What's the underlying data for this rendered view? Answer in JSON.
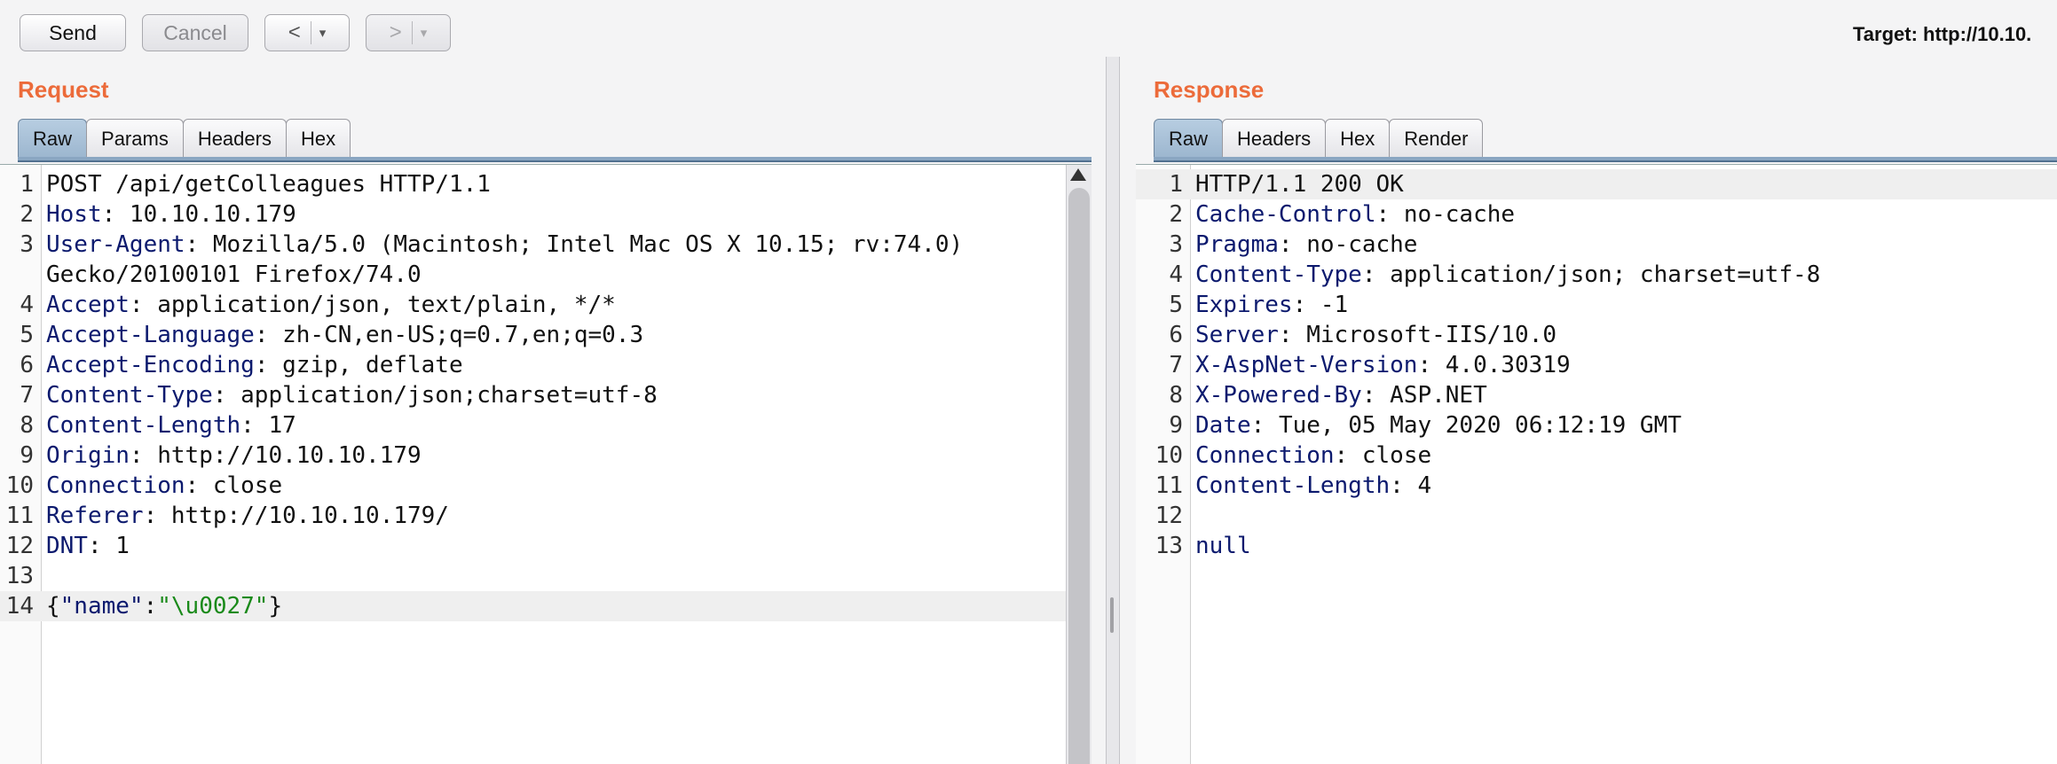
{
  "toolbar": {
    "send_label": "Send",
    "cancel_label": "Cancel",
    "back_label": "<",
    "forward_label": ">",
    "dropdown_glyph": "▾",
    "target_label": "Target: http://10.10."
  },
  "request": {
    "title": "Request",
    "tabs": [
      "Raw",
      "Params",
      "Headers",
      "Hex"
    ],
    "active_tab": "Raw",
    "lines": [
      {
        "n": "1",
        "key": "",
        "val": "POST /api/getColleagues HTTP/1.1"
      },
      {
        "n": "2",
        "key": "Host",
        "val": "10.10.10.179"
      },
      {
        "n": "3",
        "key": "User-Agent",
        "val": "Mozilla/5.0 (Macintosh; Intel Mac OS X 10.15; rv:74.0)"
      },
      {
        "n": "",
        "key": "",
        "val": "Gecko/20100101 Firefox/74.0"
      },
      {
        "n": "4",
        "key": "Accept",
        "val": "application/json, text/plain, */*"
      },
      {
        "n": "5",
        "key": "Accept-Language",
        "val": "zh-CN,en-US;q=0.7,en;q=0.3"
      },
      {
        "n": "6",
        "key": "Accept-Encoding",
        "val": "gzip, deflate"
      },
      {
        "n": "7",
        "key": "Content-Type",
        "val": "application/json;charset=utf-8"
      },
      {
        "n": "8",
        "key": "Content-Length",
        "val": "17"
      },
      {
        "n": "9",
        "key": "Origin",
        "val": "http://10.10.10.179"
      },
      {
        "n": "10",
        "key": "Connection",
        "val": "close"
      },
      {
        "n": "11",
        "key": "Referer",
        "val": "http://10.10.10.179/"
      },
      {
        "n": "12",
        "key": "DNT",
        "val": "1"
      },
      {
        "n": "13",
        "key": "",
        "val": ""
      }
    ],
    "body_line": {
      "n": "14",
      "open": "{",
      "name_key": "\"name\"",
      "colon": ":",
      "name_val": "\"\\u0027\"",
      "close": "}"
    }
  },
  "response": {
    "title": "Response",
    "tabs": [
      "Raw",
      "Headers",
      "Hex",
      "Render"
    ],
    "active_tab": "Raw",
    "lines": [
      {
        "n": "1",
        "key": "",
        "val": "HTTP/1.1 200 OK"
      },
      {
        "n": "2",
        "key": "Cache-Control",
        "val": "no-cache"
      },
      {
        "n": "3",
        "key": "Pragma",
        "val": "no-cache"
      },
      {
        "n": "4",
        "key": "Content-Type",
        "val": "application/json; charset=utf-8"
      },
      {
        "n": "5",
        "key": "Expires",
        "val": "-1"
      },
      {
        "n": "6",
        "key": "Server",
        "val": "Microsoft-IIS/10.0"
      },
      {
        "n": "7",
        "key": "X-AspNet-Version",
        "val": "4.0.30319"
      },
      {
        "n": "8",
        "key": "X-Powered-By",
        "val": "ASP.NET"
      },
      {
        "n": "9",
        "key": "Date",
        "val": "Tue, 05 May 2020 06:12:19 GMT"
      },
      {
        "n": "10",
        "key": "Connection",
        "val": "close"
      },
      {
        "n": "11",
        "key": "Content-Length",
        "val": "4"
      },
      {
        "n": "12",
        "key": "",
        "val": ""
      }
    ],
    "body_line": {
      "n": "13",
      "val": "null"
    }
  },
  "colors": {
    "title_orange": "#ec6b3a",
    "header_key": "#0c1a6e",
    "json_string": "#1a8a1a",
    "active_tab": "#a8c0d8"
  }
}
